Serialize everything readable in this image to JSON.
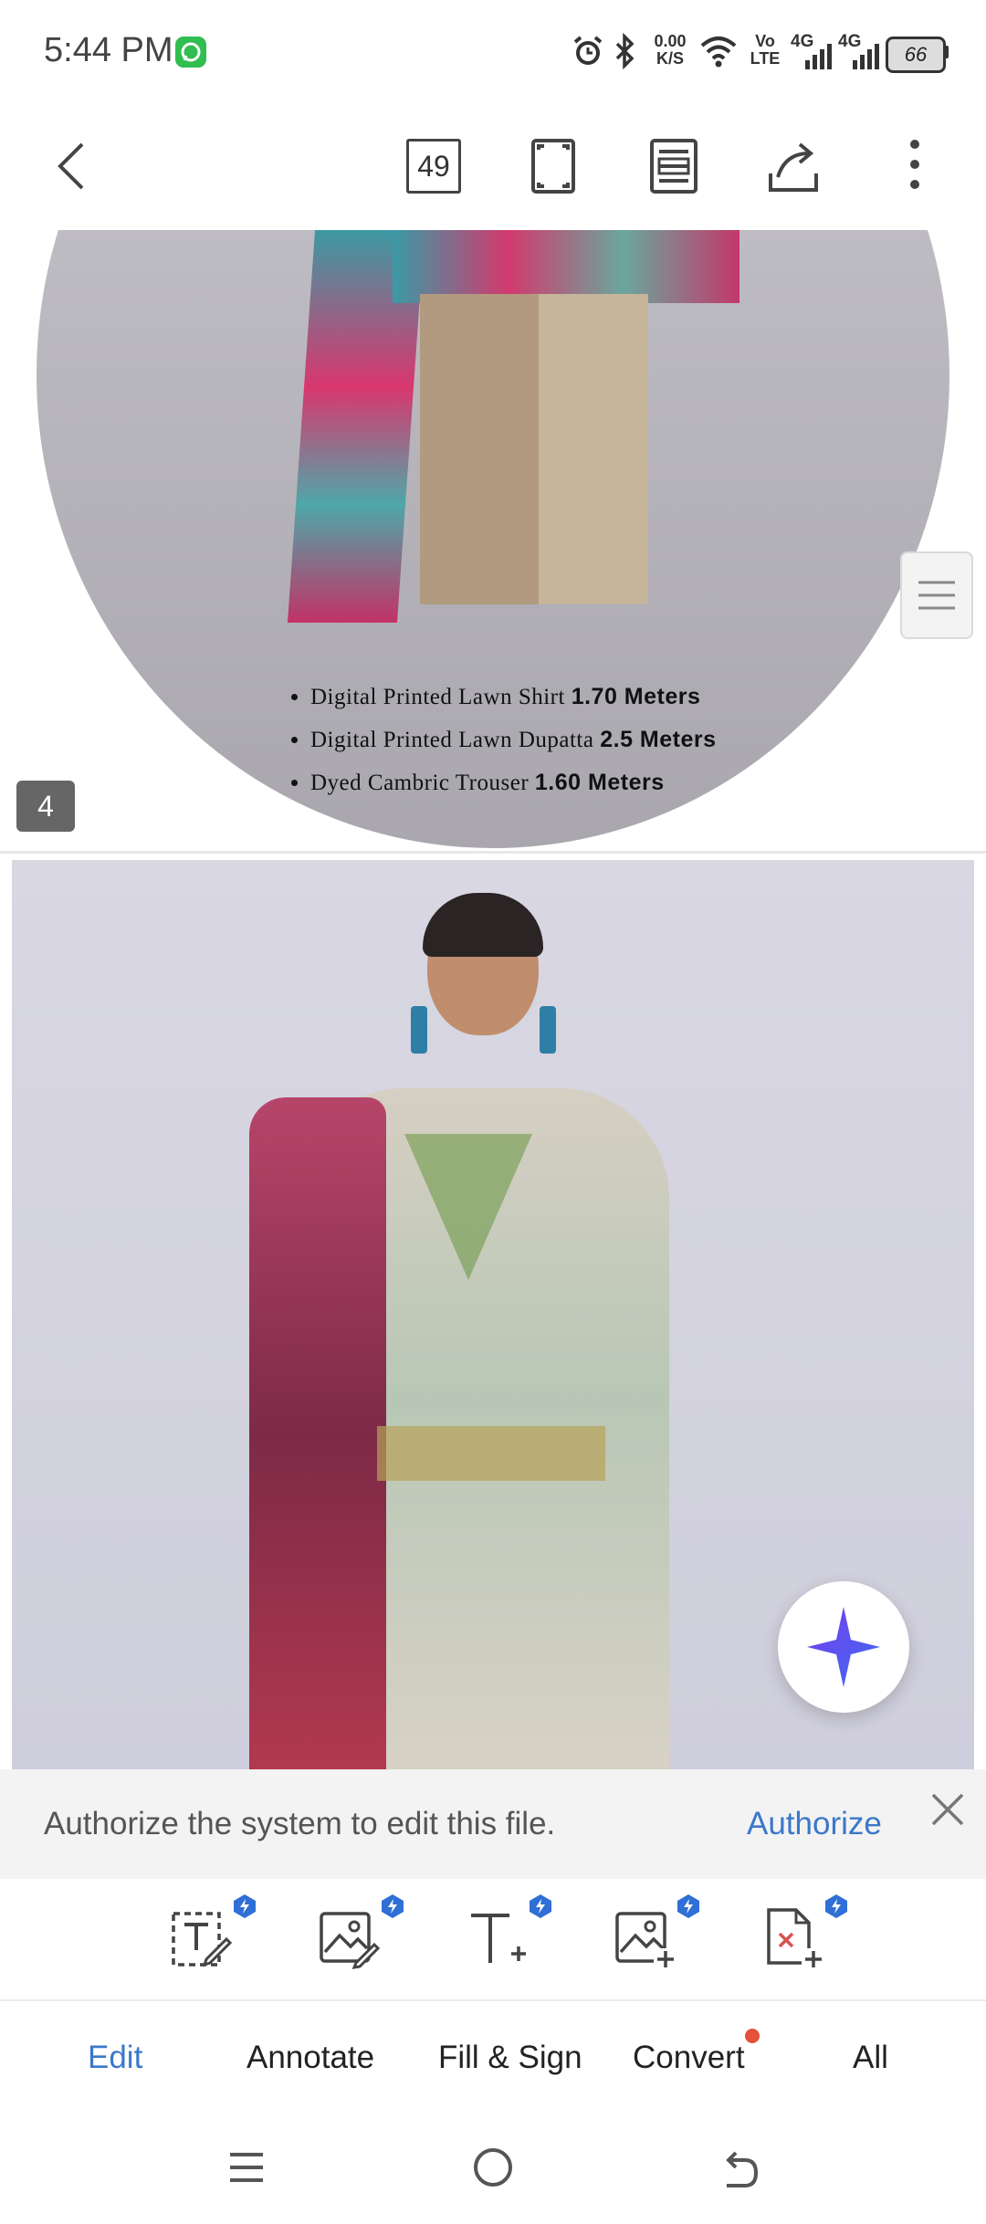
{
  "status_bar": {
    "time": "5:44 PM",
    "speed_value": "0.00",
    "speed_unit": "K/S",
    "volte_top": "Vo",
    "volte_bottom": "LTE",
    "net1": "4G",
    "net2": "4G",
    "battery": "66",
    "icons": [
      "whatsapp-icon",
      "alarm-icon",
      "bluetooth-icon",
      "wifi-icon",
      "signal-icon",
      "battery-icon"
    ]
  },
  "toolbar": {
    "page_count": "49",
    "icons": [
      "back-icon",
      "page-count",
      "fullscreen-icon",
      "page-layout-icon",
      "share-icon",
      "more-icon"
    ]
  },
  "document": {
    "bullets": [
      {
        "text": "Digital Printed Lawn Shirt ",
        "value": "1.70 Meters"
      },
      {
        "text": "Digital Printed Lawn Dupatta ",
        "value": "2.5 Meters"
      },
      {
        "text": "Dyed Cambric Trouser ",
        "value": "1.60 Meters"
      }
    ],
    "page_number": "4"
  },
  "banner": {
    "message": "Authorize the system to edit this file.",
    "action": "Authorize"
  },
  "edit_tools": [
    "edit-text-icon",
    "edit-image-icon",
    "add-text-icon",
    "add-image-icon",
    "insert-page-icon"
  ],
  "tabs": [
    {
      "label": "Edit",
      "active": true
    },
    {
      "label": "Annotate",
      "active": false
    },
    {
      "label": "Fill & Sign",
      "active": false
    },
    {
      "label": "Convert",
      "active": false,
      "dot": true
    },
    {
      "label": "All",
      "active": false
    }
  ],
  "colors": {
    "accent": "#3a78c9",
    "badge": "#2f6fd6",
    "notification_dot": "#e4523b"
  }
}
